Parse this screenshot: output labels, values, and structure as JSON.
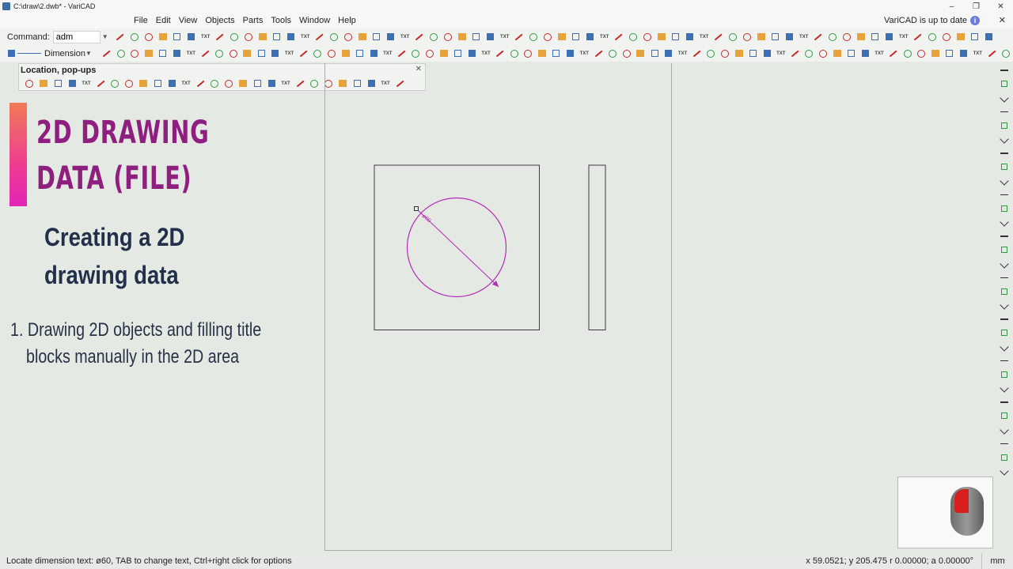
{
  "window": {
    "title": "C:\\draw\\2.dwb* - VariCAD",
    "minimize_label": "–",
    "maximize_label": "❐",
    "close_label": "✕"
  },
  "menu": {
    "items": [
      "File",
      "Edit",
      "View",
      "Objects",
      "Parts",
      "Tools",
      "Window",
      "Help"
    ],
    "update_note": "VariCAD is up to date",
    "info_glyph": "i",
    "close_glyph": "✕"
  },
  "command_bar": {
    "label": "Command:",
    "value": "adm",
    "dropdown_glyph": "▼"
  },
  "dimension_style": {
    "label": "Dimension",
    "dropdown_glyph": "▼"
  },
  "location_panel": {
    "title": "Location, pop-ups",
    "close_glyph": "✕"
  },
  "overlay": {
    "title_line1": "2D DRAWING",
    "title_line2": "DATA  (FILE)",
    "subtitle_line1": "Creating a 2D",
    "subtitle_line2": "drawing data",
    "item_line1": "1. Drawing 2D objects and filling title",
    "item_line2": "blocks manually in the 2D area"
  },
  "drawing": {
    "dimension_text": "ø60",
    "accent_color": "#b52bb5",
    "line_color": "#3a3a3a"
  },
  "status": {
    "message": "Locate dimension text: ø60, TAB to change text, Ctrl+right click for options",
    "coords": "x 59.0521; y 205.475 r 0.00000; a 0.00000°",
    "units": "mm"
  }
}
